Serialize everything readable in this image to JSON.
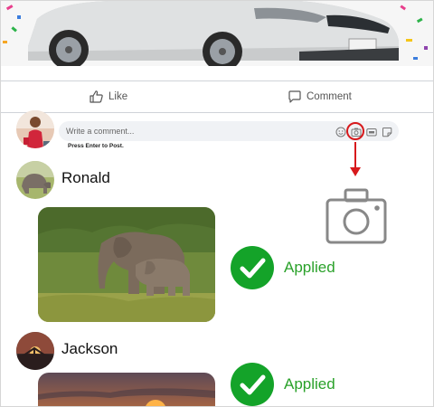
{
  "actions": {
    "like_label": "Like",
    "comment_label": "Comment"
  },
  "composer": {
    "placeholder": "Write a comment...",
    "hint": "Press Enter to Post.",
    "icons": [
      "emoji-icon",
      "camera-icon",
      "gif-icon",
      "sticker-icon"
    ]
  },
  "comments": [
    {
      "name": "Ronald",
      "status": "Applied",
      "photo": "elephants"
    },
    {
      "name": "Jackson",
      "status": "Applied",
      "photo": "sunset"
    }
  ],
  "colors": {
    "highlight": "#d7191c",
    "success": "#14a329",
    "applied_text": "#2aa12a"
  }
}
